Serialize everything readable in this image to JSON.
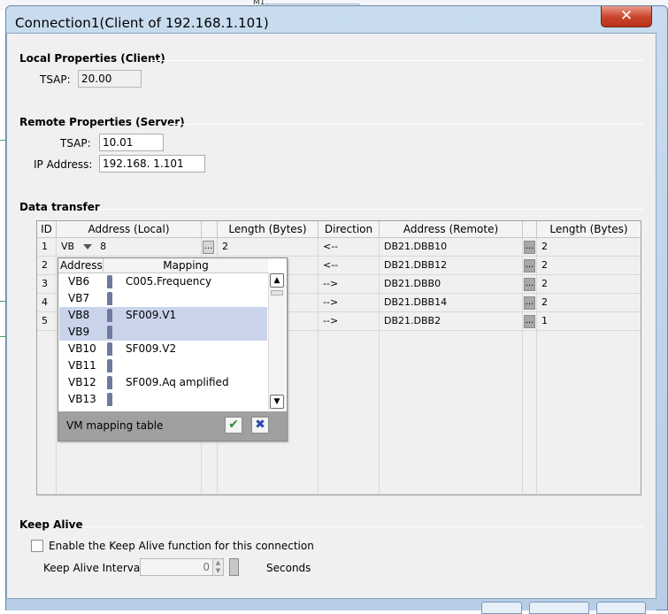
{
  "background": {
    "partial_label": "M1"
  },
  "window": {
    "title": "Connection1(Client of  192.168.1.101)",
    "close_label": "✕"
  },
  "local": {
    "heading": "Local Properties (Client)",
    "tsap_label": "TSAP:",
    "tsap_value": "20.00"
  },
  "remote": {
    "heading": "Remote Properties (Server)",
    "tsap_label": "TSAP:",
    "tsap_value": "10.01",
    "ip_label": "IP Address:",
    "ip_value": "192.168.  1.101"
  },
  "transfer": {
    "heading": "Data transfer",
    "columns": [
      "ID",
      "Address (Local)",
      "Length (Bytes)",
      "Direction",
      "Address (Remote)",
      "Length (Bytes)"
    ],
    "rows": [
      {
        "id": "1",
        "local_type": "VB",
        "local_offset": "8",
        "local_len": "2",
        "direction": "<--",
        "remote": "DB21.DBB10",
        "remote_len": "2"
      },
      {
        "id": "2",
        "local_type": "",
        "local_offset": "",
        "local_len": "",
        "direction": "<--",
        "remote": "DB21.DBB12",
        "remote_len": "2"
      },
      {
        "id": "3",
        "local_type": "",
        "local_offset": "",
        "local_len": "",
        "direction": "-->",
        "remote": "DB21.DBB0",
        "remote_len": "2"
      },
      {
        "id": "4",
        "local_type": "",
        "local_offset": "",
        "local_len": "",
        "direction": "-->",
        "remote": "DB21.DBB14",
        "remote_len": "2"
      },
      {
        "id": "5",
        "local_type": "",
        "local_offset": "",
        "local_len": "",
        "direction": "-->",
        "remote": "DB21.DBB2",
        "remote_len": "1"
      }
    ],
    "ellipsis": "..."
  },
  "mapping_popup": {
    "col_address": "Address",
    "col_mapping": "Mapping",
    "items": [
      {
        "address": "VB6",
        "mapping": "C005.Frequency",
        "selected": false
      },
      {
        "address": "VB7",
        "mapping": "",
        "selected": false
      },
      {
        "address": "VB8",
        "mapping": "SF009.V1",
        "selected": true
      },
      {
        "address": "VB9",
        "mapping": "",
        "selected": true
      },
      {
        "address": "VB10",
        "mapping": "SF009.V2",
        "selected": false
      },
      {
        "address": "VB11",
        "mapping": "",
        "selected": false
      },
      {
        "address": "VB12",
        "mapping": "SF009.Aq amplified",
        "selected": false
      },
      {
        "address": "VB13",
        "mapping": "",
        "selected": false
      }
    ],
    "footer_title": "VM mapping table",
    "ok_label": "✔",
    "cancel_label": "✖"
  },
  "keep_alive": {
    "heading": "Keep Alive",
    "enable_label": "Enable the Keep Alive function for this connection",
    "interval_label": "Keep Alive  Interval:",
    "interval_value": "0",
    "unit_label": "Seconds"
  }
}
